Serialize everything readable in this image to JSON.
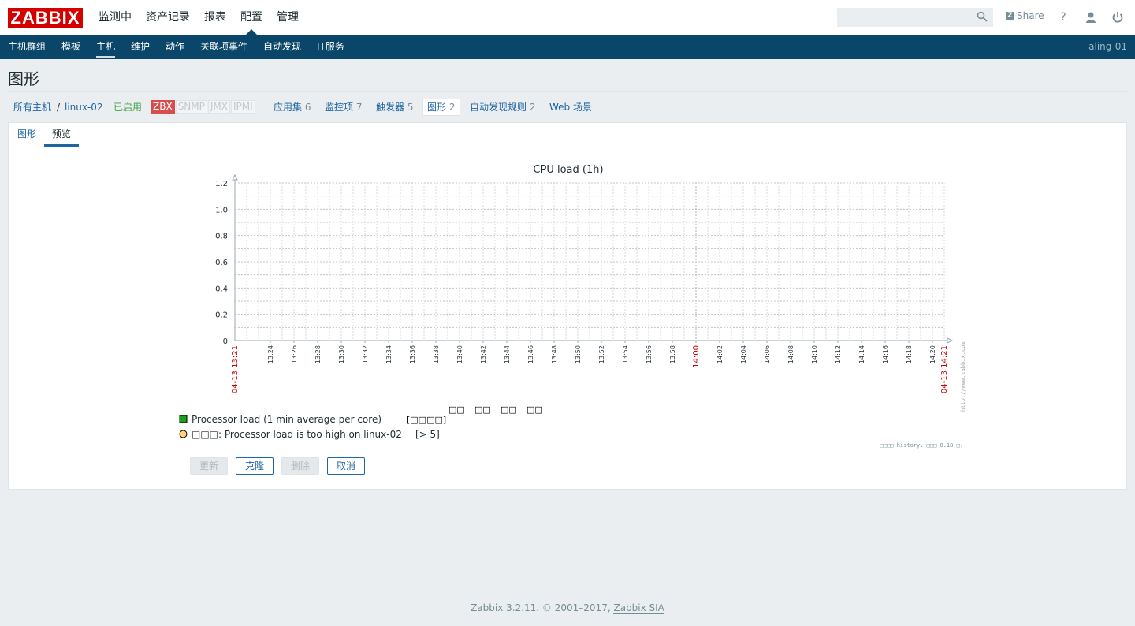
{
  "header": {
    "logo": "ZABBIX",
    "main_nav": [
      "监测中",
      "资产记录",
      "报表",
      "配置",
      "管理"
    ],
    "active_main": "配置",
    "share_label": "Share",
    "search_placeholder": ""
  },
  "subnav": {
    "items": [
      "主机群组",
      "模板",
      "主机",
      "维护",
      "动作",
      "关联项事件",
      "自动发现",
      "IT服务"
    ],
    "active": "主机",
    "user": "aling-01"
  },
  "page": {
    "title": "图形"
  },
  "breadcrumb": {
    "all_hosts": "所有主机",
    "separator": "/",
    "host": "linux-02",
    "status": "已启用",
    "availability": [
      "ZBX",
      "SNMP",
      "JMX",
      "IPMI"
    ],
    "links": [
      {
        "label": "应用集",
        "count": "6"
      },
      {
        "label": "监控项",
        "count": "7"
      },
      {
        "label": "触发器",
        "count": "5"
      },
      {
        "label": "图形",
        "count": "2"
      },
      {
        "label": "自动发现规则",
        "count": "2"
      },
      {
        "label": "Web 场景",
        "count": ""
      }
    ]
  },
  "tabs": {
    "graph": "图形",
    "preview": "预览",
    "active": "预览"
  },
  "chart_data": {
    "type": "line",
    "title": "CPU load (1h)",
    "ylim": [
      0,
      1.2
    ],
    "y_ticks": [
      "0",
      "0.2",
      "0.4",
      "0.6",
      "0.8",
      "1.0",
      "1.2"
    ],
    "x_start_label": "04-13 13:21",
    "x_end_label": "04-13 14:21",
    "x_ticks": [
      "13:24",
      "13:26",
      "13:28",
      "13:30",
      "13:32",
      "13:34",
      "13:36",
      "13:38",
      "13:40",
      "13:42",
      "13:44",
      "13:46",
      "13:48",
      "13:50",
      "13:52",
      "13:54",
      "13:56",
      "13:58",
      "14:00",
      "14:02",
      "14:04",
      "14:06",
      "14:08",
      "14:10",
      "14:12",
      "14:14",
      "14:16",
      "14:18",
      "14:20"
    ],
    "highlight_tick": "14:00",
    "grid": true,
    "watermark": "http://www.zabbix.com",
    "stat_headers": [
      "□□",
      "□□",
      "□□",
      "□□"
    ],
    "series": [
      {
        "name": "Processor load (1 min average per core)",
        "func": "[□□□□]",
        "color": "#1aa01a",
        "values": []
      }
    ],
    "triggers": [
      {
        "label": "□□□: Processor load is too high on linux-02",
        "condition": "[> 5]",
        "color": "#ffd47a"
      }
    ],
    "footnote": "□□□□ history. □□□ 0.18 □."
  },
  "buttons": {
    "update": "更新",
    "clone": "克隆",
    "delete": "删除",
    "cancel": "取消"
  },
  "footer": {
    "text": "Zabbix 3.2.11. © 2001–2017, ",
    "link": "Zabbix SIA"
  }
}
